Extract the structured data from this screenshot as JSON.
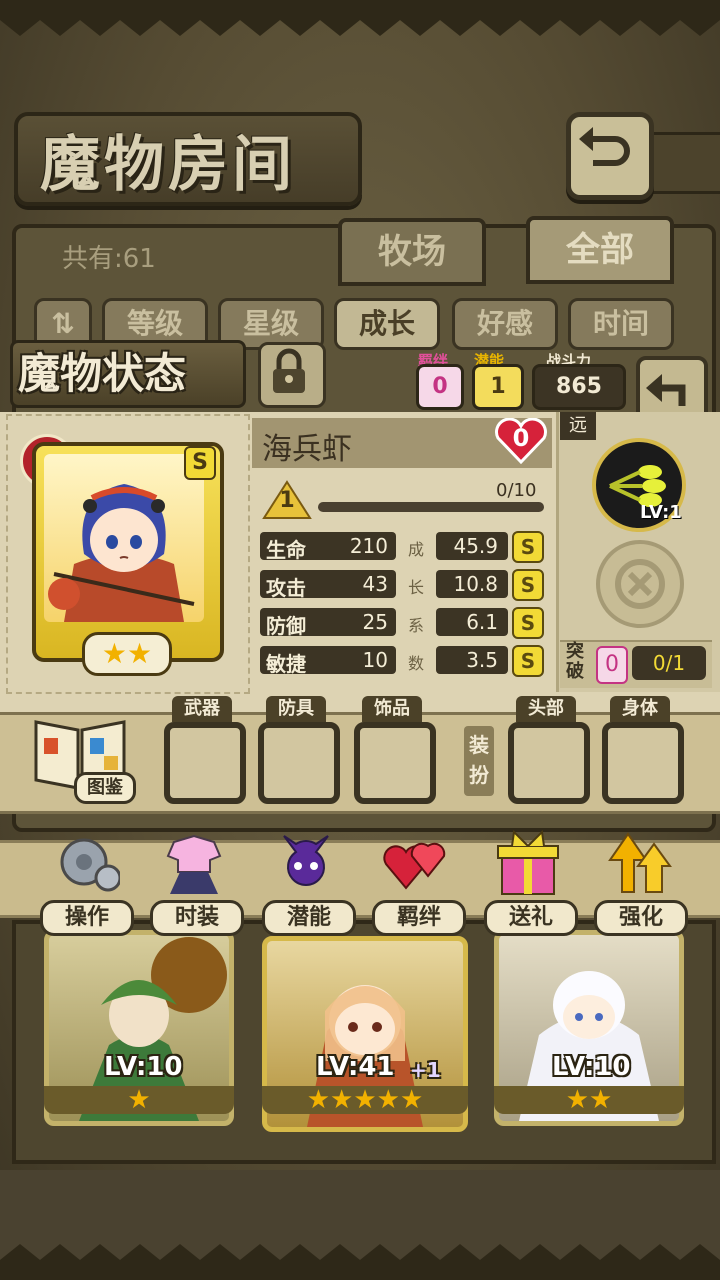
{
  "header": {
    "title": "魔物房间"
  },
  "list": {
    "count_text": "共有:61",
    "tabs": [
      {
        "label": "牧场"
      },
      {
        "label": "全部"
      }
    ]
  },
  "sort": {
    "buttons": [
      {
        "label": "等级"
      },
      {
        "label": "星级"
      },
      {
        "label": "成长"
      },
      {
        "label": "好感"
      },
      {
        "label": "时间"
      }
    ],
    "active": "成长"
  },
  "status": {
    "title": "魔物状态",
    "bond": {
      "label": "羁绊",
      "value": "0"
    },
    "potential": {
      "label": "潜能",
      "value": "1"
    },
    "power": {
      "label": "战斗力",
      "value": "865"
    }
  },
  "monster": {
    "name": "海兵虾",
    "heart_count": "0",
    "rank_badge": "S",
    "stars": 2,
    "level_badge": "1",
    "exp_text": "0/10",
    "exp_fraction": 0.0,
    "stats": [
      {
        "name": "生命",
        "value": "210",
        "growth": "45.9",
        "grade": "S"
      },
      {
        "name": "攻击",
        "value": "43",
        "growth": "10.8",
        "grade": "S"
      },
      {
        "name": "防御",
        "value": "25",
        "growth": "6.1",
        "grade": "S"
      },
      {
        "name": "敏捷",
        "value": "10",
        "growth": "3.5",
        "grade": "S"
      }
    ],
    "growth_label_chars": [
      "成",
      "长",
      "系",
      "数"
    ],
    "range_tag": "远",
    "skill_level": "LV:1",
    "breakthrough": {
      "label_top": "突",
      "label_bottom": "破",
      "count": "0",
      "progress": "0/1"
    }
  },
  "equipment": {
    "book_label": "图鉴",
    "slots": [
      {
        "label": "武器"
      },
      {
        "label": "防具"
      },
      {
        "label": "饰品"
      },
      {
        "label": "头部"
      },
      {
        "label": "身体"
      }
    ],
    "outfit_label_top": "装",
    "outfit_label_bottom": "扮"
  },
  "actions": [
    {
      "label": "操作",
      "icon": "gear-icon"
    },
    {
      "label": "时装",
      "icon": "outfit-icon"
    },
    {
      "label": "潜能",
      "icon": "potential-icon"
    },
    {
      "label": "羁绊",
      "icon": "hearts-icon"
    },
    {
      "label": "送礼",
      "icon": "gift-icon"
    },
    {
      "label": "强化",
      "icon": "upgrade-arrows-icon"
    }
  ],
  "grid_cards": [
    {
      "level": "LV:10",
      "stars": 1,
      "plus": ""
    },
    {
      "level": "LV:41",
      "stars": 5,
      "plus": "+1"
    },
    {
      "level": "LV:10",
      "stars": 2,
      "plus": ""
    }
  ],
  "colors": {
    "accent_gold": "#f2da36",
    "panel": "#ddd3b3",
    "dark": "#3c3424",
    "pink": "#e0509a",
    "heart": "#d6223a"
  }
}
